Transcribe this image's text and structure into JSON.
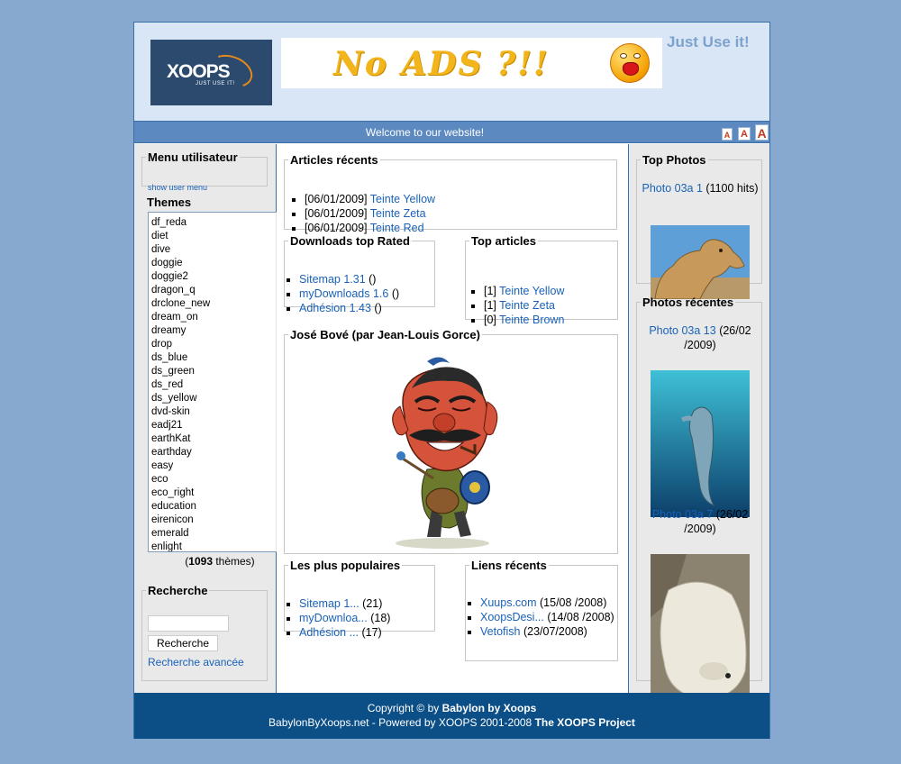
{
  "header": {
    "logo_text": "XOOPS",
    "logo_tagline": "JUST USE IT!",
    "banner_text": "No ADS ?!!",
    "tagline": "Just Use it!"
  },
  "welcome": {
    "text": "Welcome to our website!",
    "font_sizes": [
      "A",
      "A",
      "A"
    ]
  },
  "left": {
    "menu": {
      "title": "Menu utilisateur",
      "toggle": "show user menu"
    },
    "themes": {
      "title": "Themes",
      "items": [
        "df_reda",
        "diet",
        "dive",
        "doggie",
        "doggie2",
        "dragon_q",
        "drclone_new",
        "dream_on",
        "dreamy",
        "drop",
        "ds_blue",
        "ds_green",
        "ds_red",
        "ds_yellow",
        "dvd-skin",
        "eadj21",
        "earthKat",
        "earthday",
        "easy",
        "eco",
        "eco_right",
        "education",
        "eirenicon",
        "emerald",
        "enlight"
      ],
      "count": "1093",
      "count_suffix": " thèmes)",
      "count_prefix": "("
    },
    "search": {
      "title": "Recherche",
      "button": "Recherche",
      "advanced": "Recherche avancée"
    }
  },
  "center": {
    "articles": {
      "title": "Articles récents",
      "items": [
        {
          "date": "[06/01/2009]",
          "link": "Teinte Yellow"
        },
        {
          "date": "[06/01/2009]",
          "link": "Teinte Zeta"
        },
        {
          "date": "[06/01/2009]",
          "link": "Teinte Red"
        }
      ]
    },
    "downloads": {
      "title": "Downloads top Rated",
      "items": [
        {
          "link": "Sitemap 1.31",
          "suffix": " ()"
        },
        {
          "link": "myDownloads 1.6",
          "suffix": " ()"
        },
        {
          "link": "Adhésion 1.43",
          "suffix": " ()"
        }
      ]
    },
    "top_articles": {
      "title": "Top articles",
      "items": [
        {
          "count": "[1]",
          "link": "Teinte Yellow"
        },
        {
          "count": "[1]",
          "link": "Teinte Zeta"
        },
        {
          "count": "[0]",
          "link": "Teinte Brown"
        }
      ]
    },
    "caricature": {
      "title": "José Bové (par Jean-Louis Gorce)"
    },
    "populaires": {
      "title": "Les plus populaires",
      "items": [
        {
          "link": "Sitemap 1...",
          "suffix": " (21)"
        },
        {
          "link": "myDownloa...",
          "suffix": " (18)"
        },
        {
          "link": "Adhésion ...",
          "suffix": " (17)"
        }
      ]
    },
    "liens": {
      "title": "Liens récents",
      "items": [
        {
          "link": "Xuups.com",
          "suffix": " (15/08 /2008)"
        },
        {
          "link": "XoopsDesi...",
          "suffix": " (14/08 /2008)"
        },
        {
          "link": "Vetofish",
          "suffix": " (23/07/2008)"
        }
      ]
    }
  },
  "right": {
    "top_photos": {
      "title": "Top Photos",
      "photo": {
        "link": "Photo 03a 1",
        "suffix": " (1100 hits)"
      }
    },
    "recent_photos": {
      "title": "Photos récentes",
      "photos": [
        {
          "link": "Photo 03a 13",
          "suffix": " (26/02 /2009)"
        },
        {
          "link": "Photo 03a 7",
          "suffix": " (26/02 /2009)"
        }
      ]
    }
  },
  "footer": {
    "line1_prefix": "Copyright © by ",
    "line1_bold": "Babylon by Xoops",
    "line2_prefix": "BabylonByXoops.net - Powered by XOOPS 2001-2008 ",
    "line2_bold": "The XOOPS Project"
  }
}
